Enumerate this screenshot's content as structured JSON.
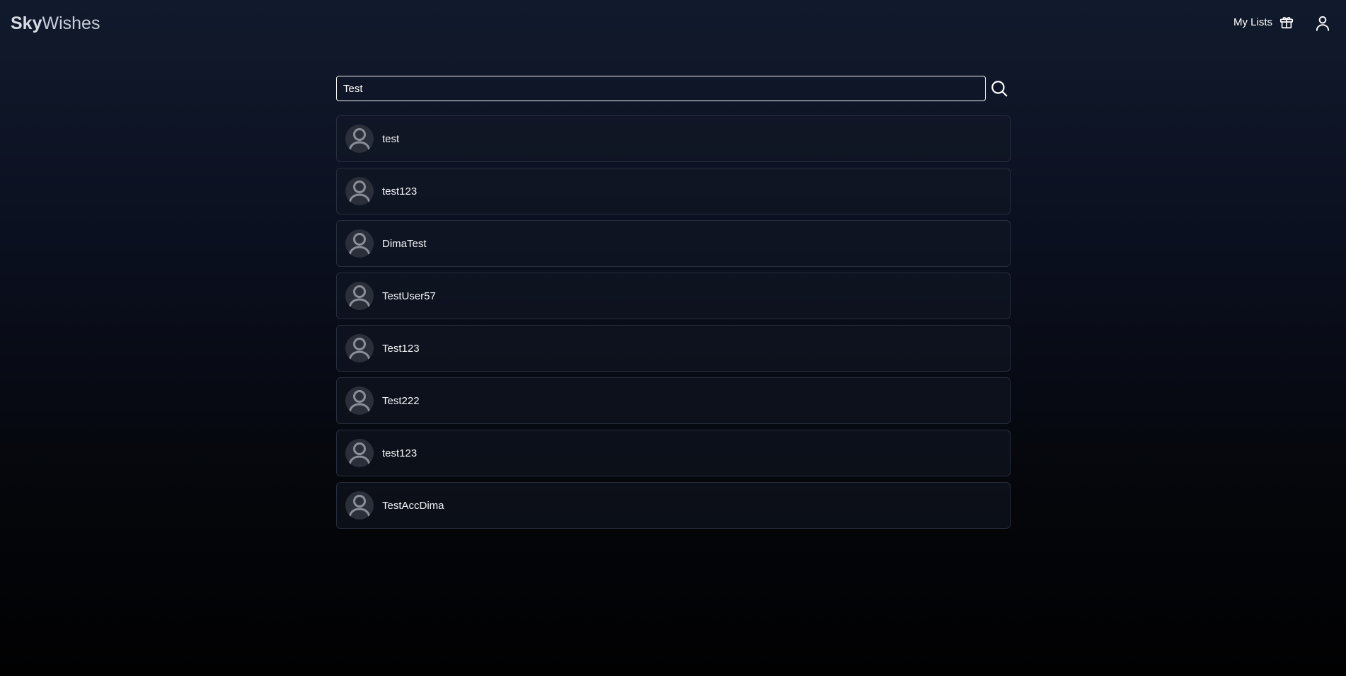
{
  "header": {
    "logo_bold": "Sky",
    "logo_light": "Wishes",
    "my_lists_label": "My Lists",
    "my_lists_icon": "gift-icon",
    "profile_icon": "user-icon"
  },
  "search": {
    "value": "Test",
    "icon": "search-icon"
  },
  "results": [
    {
      "name": "test"
    },
    {
      "name": "test123"
    },
    {
      "name": "DimaTest"
    },
    {
      "name": "TestUser57"
    },
    {
      "name": "Test123"
    },
    {
      "name": "Test222"
    },
    {
      "name": "test123"
    },
    {
      "name": "TestAccDima"
    }
  ],
  "colors": {
    "background_top": "#111a2c",
    "background_bottom": "#010102",
    "card_border": "#262d3c",
    "avatar_bg": "#2a2f3a",
    "avatar_glyph": "#8b8f97"
  }
}
